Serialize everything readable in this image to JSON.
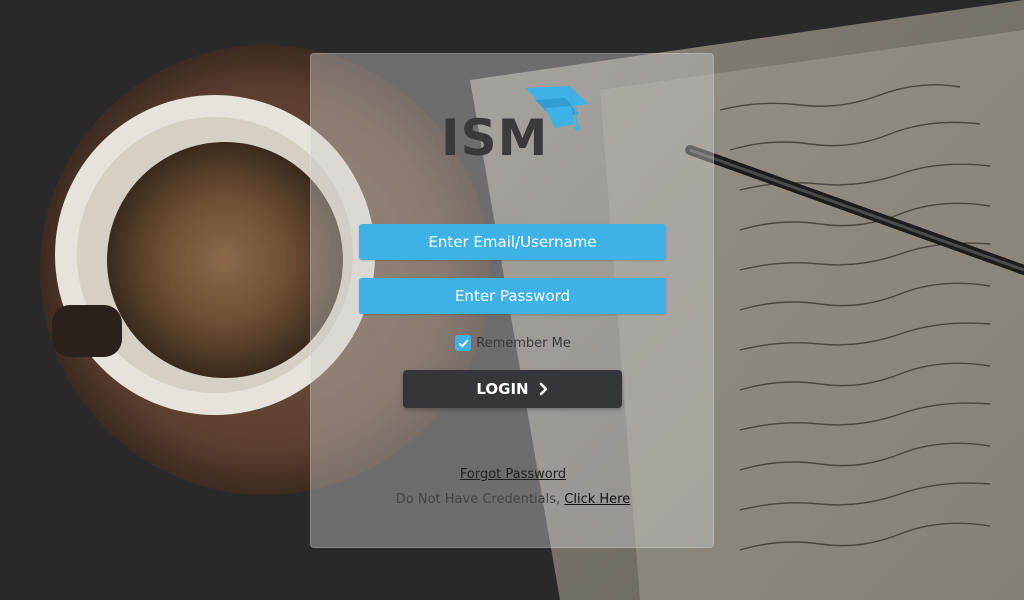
{
  "brand": {
    "logo_text": "ISM",
    "accent_color": "#3eb1e6",
    "dark_color": "#3a3a3a"
  },
  "login_form": {
    "email_placeholder": "Enter Email/Username",
    "password_placeholder": "Enter Password",
    "remember_label": "Remember Me",
    "remember_checked": true,
    "login_label": "LOGIN",
    "forgot_password_label": "Forgot Password",
    "no_credentials_text": "Do Not Have Credentials,",
    "click_here_label": "Click Here"
  },
  "icons": {
    "logo": "graduation-cap-icon",
    "checkbox": "check-icon",
    "login_arrow": "chevron-right-icon"
  },
  "background": {
    "description_color": "#2a2a2a"
  }
}
